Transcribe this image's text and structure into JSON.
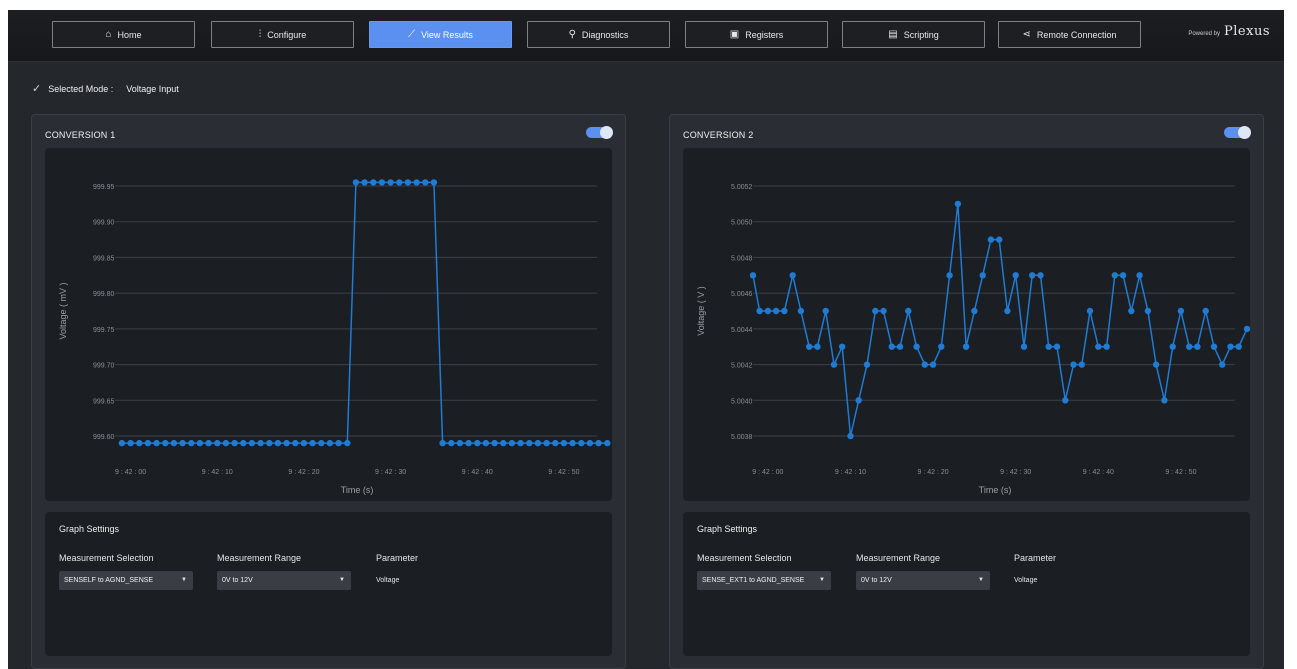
{
  "nav": {
    "items": [
      {
        "label": "Home",
        "icon": "home-icon",
        "glyph": "⌂",
        "active": false
      },
      {
        "label": "Configure",
        "icon": "sliders-icon",
        "glyph": "⫶",
        "active": false
      },
      {
        "label": "View Results",
        "icon": "chart-icon",
        "glyph": "⟋",
        "active": true
      },
      {
        "label": "Diagnostics",
        "icon": "search-icon",
        "glyph": "⚲",
        "active": false
      },
      {
        "label": "Registers",
        "icon": "chip-icon",
        "glyph": "▣",
        "active": false
      },
      {
        "label": "Scripting",
        "icon": "script-icon",
        "glyph": "▤",
        "active": false
      },
      {
        "label": "Remote Connection",
        "icon": "share-icon",
        "glyph": "⋖",
        "active": false
      }
    ],
    "brand_prefix": "Powered by",
    "brand_name": "Plexus"
  },
  "mode": {
    "label": "Selected Mode :",
    "value": "Voltage Input"
  },
  "colors": {
    "accent": "#5b8ff0",
    "series": "#1f7bd3",
    "panel": "#2a2d33",
    "card": "#1b1e22"
  },
  "panels": [
    {
      "title": "CONVERSION 1",
      "toggle_on": true,
      "settings": {
        "title": "Graph Settings",
        "selection_label": "Measurement Selection",
        "selection_value": "SENSELF to AGND_SENSE",
        "range_label": "Measurement Range",
        "range_value": "0V to 12V",
        "parameter_label": "Parameter",
        "parameter_value": "Voltage"
      }
    },
    {
      "title": "CONVERSION 2",
      "toggle_on": true,
      "settings": {
        "title": "Graph Settings",
        "selection_label": "Measurement Selection",
        "selection_value": "SENSE_EXT1 to AGND_SENSE",
        "range_label": "Measurement Range",
        "range_value": "0V to 12V",
        "parameter_label": "Parameter",
        "parameter_value": "Voltage"
      }
    }
  ],
  "chart_data": [
    {
      "type": "line",
      "xlabel": "Time (s)",
      "ylabel": "Voltage ( mV )",
      "ylim": [
        999.6,
        999.95
      ],
      "yticks": [
        "999.95",
        "999.90",
        "999.85",
        "999.80",
        "999.75",
        "999.70",
        "999.65",
        "999.60"
      ],
      "xticks": [
        "9 : 42 : 00",
        "9 : 42 : 10",
        "9 : 42 : 20",
        "9 : 42 : 30",
        "9 : 42 : 40",
        "9 : 42 : 50"
      ],
      "xtick_values": [
        0,
        10,
        20,
        30,
        40,
        50
      ],
      "xlim": [
        -1.8,
        55.2
      ],
      "grid": true,
      "series": [
        {
          "x": [
            -1,
            0,
            1,
            2,
            3,
            4,
            5,
            6,
            7,
            8,
            9,
            10,
            11,
            12,
            13,
            14,
            15,
            16,
            17,
            18,
            19,
            20,
            21,
            22,
            23,
            24,
            25,
            26,
            27,
            28,
            29,
            30,
            31,
            32,
            33,
            34,
            35,
            36,
            37,
            38,
            39,
            40,
            41,
            42,
            43,
            44,
            45,
            46,
            47,
            48,
            49,
            50,
            51,
            52,
            53,
            54,
            55
          ],
          "values": [
            999.59,
            999.59,
            999.59,
            999.59,
            999.59,
            999.59,
            999.59,
            999.59,
            999.59,
            999.59,
            999.59,
            999.59,
            999.59,
            999.59,
            999.59,
            999.59,
            999.59,
            999.59,
            999.59,
            999.59,
            999.59,
            999.59,
            999.59,
            999.59,
            999.59,
            999.59,
            999.59,
            999.955,
            999.955,
            999.955,
            999.955,
            999.955,
            999.955,
            999.955,
            999.955,
            999.955,
            999.955,
            999.59,
            999.59,
            999.59,
            999.59,
            999.59,
            999.59,
            999.59,
            999.59,
            999.59,
            999.59,
            999.59,
            999.59,
            999.59,
            999.59,
            999.59,
            999.59,
            999.59,
            999.59,
            999.59,
            999.59
          ]
        }
      ]
    },
    {
      "type": "line",
      "xlabel": "Time (s)",
      "ylabel": "Voltage ( V )",
      "ylim": [
        5.0038,
        5.0052
      ],
      "yticks": [
        "5.0052",
        "5.0050",
        "5.0048",
        "5.0046",
        "5.0044",
        "5.0042",
        "5.0040",
        "5.0038"
      ],
      "xticks": [
        "9 : 42 : 00",
        "9 : 42 : 10",
        "9 : 42 : 20",
        "9 : 42 : 30",
        "9 : 42 : 40",
        "9 : 42 : 50"
      ],
      "xtick_values": [
        0,
        10,
        20,
        30,
        40,
        50
      ],
      "xlim": [
        -1.8,
        58
      ],
      "grid": true,
      "series": [
        {
          "x": [
            -1.8,
            -1,
            0,
            1,
            2,
            3,
            4,
            5,
            6,
            7,
            8,
            9,
            10,
            11,
            12,
            13,
            14,
            15,
            16,
            17,
            18,
            19,
            20,
            21,
            22,
            23,
            24,
            25,
            26,
            27,
            28,
            29,
            30,
            31,
            32,
            33,
            34,
            35,
            36,
            37,
            38,
            39,
            40,
            41,
            42,
            43,
            44,
            45,
            46,
            47,
            48,
            49,
            50,
            51,
            52,
            53,
            54,
            55,
            56,
            57,
            58
          ],
          "values": [
            5.0047,
            5.0045,
            5.0045,
            5.0045,
            5.0045,
            5.0047,
            5.0045,
            5.0043,
            5.0043,
            5.0045,
            5.0042,
            5.0043,
            5.0038,
            5.004,
            5.0042,
            5.0045,
            5.0045,
            5.0043,
            5.0043,
            5.0045,
            5.0043,
            5.0042,
            5.0042,
            5.0043,
            5.0047,
            5.0051,
            5.0043,
            5.0045,
            5.0047,
            5.0049,
            5.0049,
            5.0045,
            5.0047,
            5.0043,
            5.0047,
            5.0047,
            5.0043,
            5.0043,
            5.004,
            5.0042,
            5.0042,
            5.0045,
            5.0043,
            5.0043,
            5.0047,
            5.0047,
            5.0045,
            5.0047,
            5.0045,
            5.0042,
            5.004,
            5.0043,
            5.0045,
            5.0043,
            5.0043,
            5.0045,
            5.0043,
            5.0042,
            5.0043,
            5.0043,
            5.0044
          ]
        }
      ]
    }
  ]
}
